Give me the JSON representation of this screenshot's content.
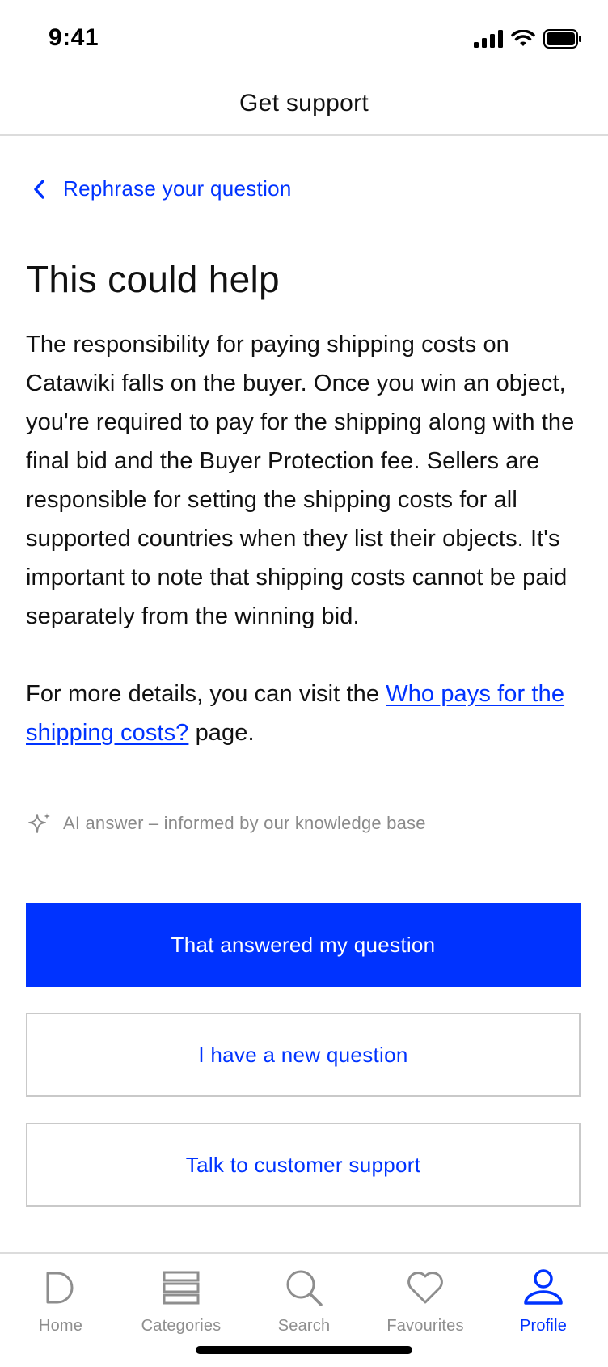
{
  "status_bar": {
    "time": "9:41"
  },
  "header": {
    "title": "Get support"
  },
  "back_link": {
    "label": "Rephrase your question"
  },
  "answer": {
    "heading": "This could help",
    "paragraph": "The responsibility for paying shipping costs on Catawiki falls on the buyer. Once you win an object, you're required to pay for the shipping along with the final bid and the Buyer Protection fee. Sellers are responsible for setting the shipping costs for all supported countries when they list their objects. It's important to note that shipping costs cannot be paid separately from the winning bid.",
    "more_prefix": "For more details, you can visit the ",
    "more_link": "Who pays for the shipping costs?",
    "more_suffix": " page.",
    "ai_note": "AI answer – informed by our knowledge base"
  },
  "buttons": {
    "answered": "That answered my question",
    "new_question": "I have a new question",
    "talk_support": "Talk to customer support"
  },
  "tabs": [
    {
      "label": "Home",
      "icon": "home-icon",
      "active": false
    },
    {
      "label": "Categories",
      "icon": "categories-icon",
      "active": false
    },
    {
      "label": "Search",
      "icon": "search-icon",
      "active": false
    },
    {
      "label": "Favourites",
      "icon": "heart-icon",
      "active": false
    },
    {
      "label": "Profile",
      "icon": "profile-icon",
      "active": true
    }
  ],
  "colors": {
    "accent": "#0033ff",
    "muted": "#8e8e8e",
    "border": "#c9c9c9"
  }
}
